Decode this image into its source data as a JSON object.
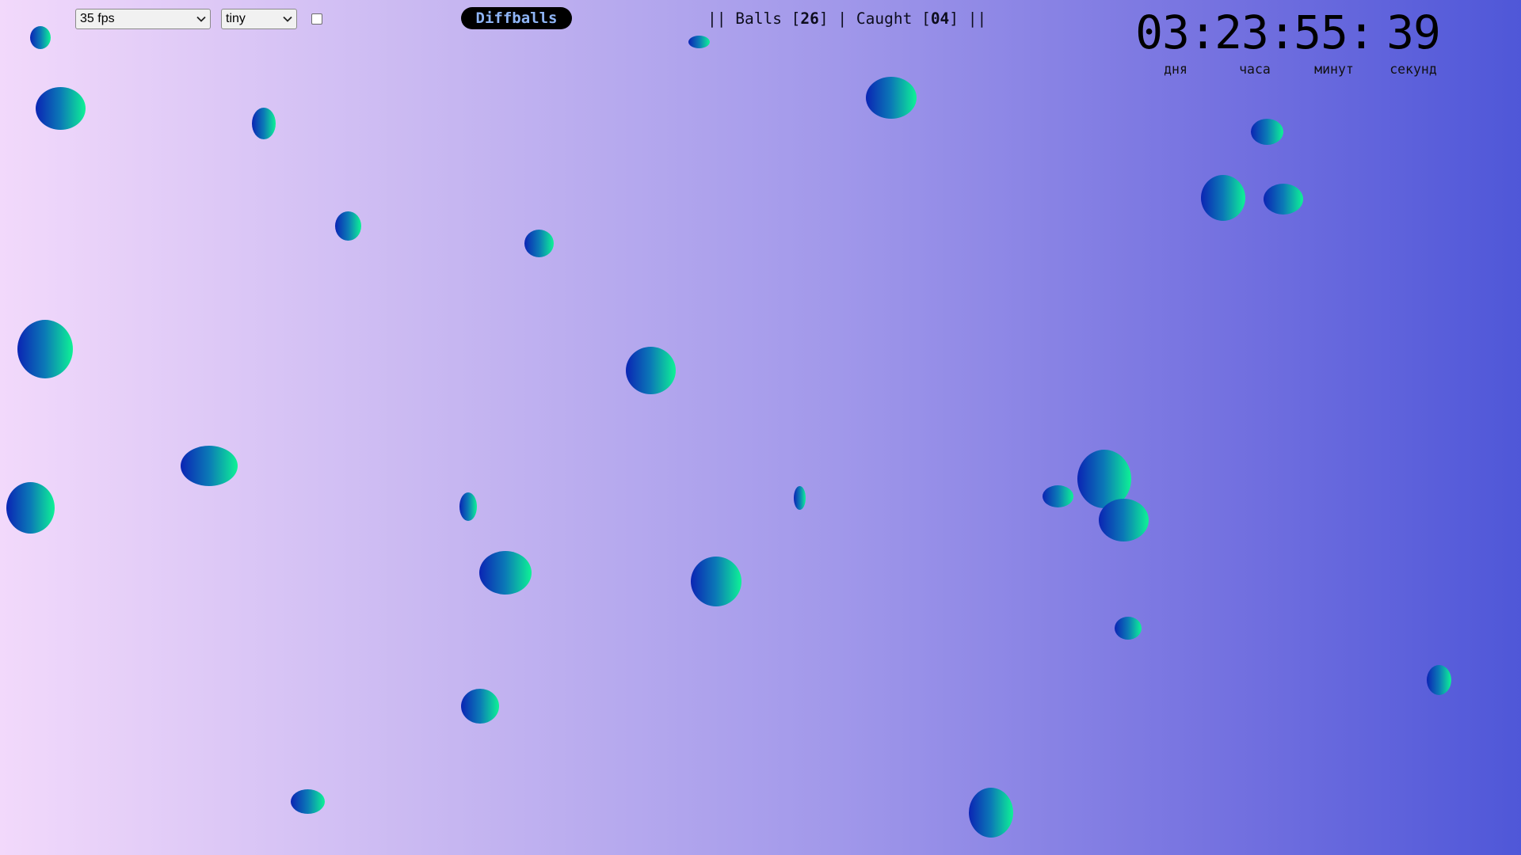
{
  "controls": {
    "fps_value": "35 fps",
    "size_value": "tiny",
    "checkbox_checked": false
  },
  "game_title": "Diffballs",
  "stats": {
    "balls_label": "Balls",
    "balls_count": "26",
    "caught_label": "Caught",
    "caught_count": "04"
  },
  "timer": {
    "days": "03:",
    "days_label": "дня",
    "hours": "23:",
    "hours_label": "часа",
    "minutes": "55:",
    "minutes_label": "минут",
    "seconds": "39",
    "seconds_label": "секунд"
  },
  "icons": {
    "select_arrow": "chevron-down-icon"
  },
  "colors": {
    "background_left": "#f2d9fb",
    "background_right": "#4f57d8",
    "ball_gradient": [
      "#0b24b4",
      "#0ef395"
    ],
    "title_pill_bg": "#000000",
    "title_pill_text": "#8fb5f6"
  }
}
